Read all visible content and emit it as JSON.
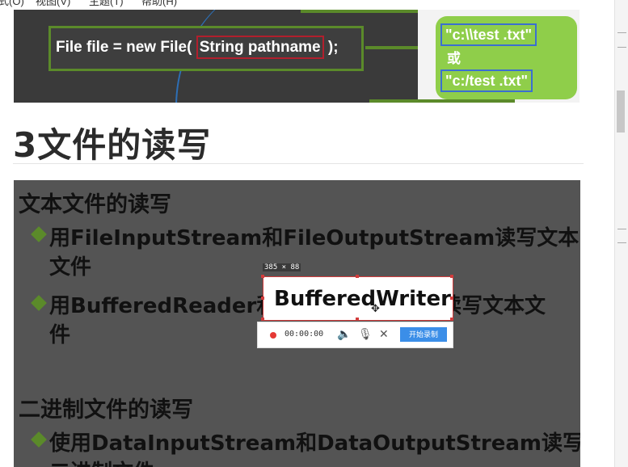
{
  "menubar": {
    "items": [
      "式(O)",
      "视图(V)",
      "主题(T)",
      "帮助(H)"
    ]
  },
  "slide1": {
    "code_prefix": "File file = new File( ",
    "code_highlight": "String pathname",
    "code_suffix": " );",
    "path_backslash": "\"c:\\\\test .txt\"",
    "or_text": "或",
    "path_slash": "\"c:/test .txt\""
  },
  "heading": "3文件的读写",
  "slide2": {
    "section1": "文本文件的读写",
    "bullet1_line1": "用FileInputStream和FileOutputStream读写文本",
    "bullet1_line2": "文件",
    "bullet2_before": "用BufferedReader和",
    "bullet2_after": "读写文本文",
    "bullet2_line2": "件",
    "section2": "二进制文件的读写",
    "bullet3_line1": "使用DataInputStream和DataOutputStream读写",
    "bullet3_line2": "二进制文件"
  },
  "capture": {
    "dimensions_label": "385 × 88",
    "selected_text": "BufferedWriter",
    "timer": "00:00:00",
    "start_button": "开始录制"
  },
  "colors": {
    "accent_green": "#5b8a2a",
    "bubble_green": "#8fce4a",
    "record_red": "#e53935",
    "start_blue": "#3b8ee8"
  }
}
